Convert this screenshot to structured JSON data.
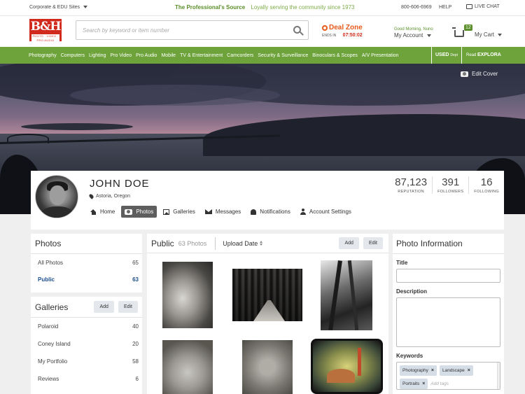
{
  "utilbar": {
    "corp_label": "Corporate & EDU Sites",
    "tagline_pro": "The Professional's Source",
    "tagline_loyal": "Loyally serving the community since 1973",
    "phone": "800-606-6969",
    "help": "HELP",
    "chat": "LIVE CHAT"
  },
  "header": {
    "logo_big": "B&H",
    "logo_small": "PHOTO · VIDEO · PRO AUDIO",
    "search_placeholder": "Search by keyword or item number",
    "dealzone_title": "Deal Zone",
    "dealzone_ends": "ENDS IN",
    "dealzone_time": "07:50:02",
    "greeting": "Good Morning, Nuno",
    "my_account": "My Account",
    "cart_count": "12",
    "my_cart": "My Cart"
  },
  "nav": {
    "items": [
      "Photography",
      "Computers",
      "Lighting",
      "Pro Video",
      "Pro Audio",
      "Mobile",
      "TV & Entertainment",
      "Camcorders",
      "Security & Surveillance",
      "Binoculars & Scopes",
      "A/V Presentation"
    ],
    "used": "USED",
    "used_dept": "Dept",
    "explora_read": "Read",
    "explora": "EXPLORA"
  },
  "cover": {
    "edit_label": "Edit Cover"
  },
  "profile": {
    "name": "JOHN DOE",
    "location": "Astoria, Oregon",
    "tabs": [
      "Home",
      "Photos",
      "Galleries",
      "Messages",
      "Notifications",
      "Account Settings"
    ],
    "active_tab": "Photos",
    "stats": [
      {
        "num": "87,123",
        "label": "REPUTATION"
      },
      {
        "num": "391",
        "label": "FOLLOWERS"
      },
      {
        "num": "16",
        "label": "FOLLOWING"
      }
    ]
  },
  "photos_panel": {
    "title": "Photos",
    "rows": [
      {
        "label": "All Photos",
        "count": "65"
      },
      {
        "label": "Public",
        "count": "63"
      }
    ]
  },
  "galleries_panel": {
    "title": "Galleries",
    "add": "Add",
    "edit": "Edit",
    "rows": [
      {
        "label": "Polaroid",
        "count": "40"
      },
      {
        "label": "Coney Island",
        "count": "20"
      },
      {
        "label": "My Portfolio",
        "count": "58"
      },
      {
        "label": "Reviews",
        "count": "6"
      }
    ]
  },
  "grid_panel": {
    "title": "Public",
    "count": "63 Photos",
    "sort": "Upload Date",
    "add": "Add",
    "edit": "Edit"
  },
  "info_panel": {
    "title": "Photo Information",
    "title_label": "Title",
    "description_label": "Description",
    "keywords_label": "Keywords",
    "keywords": [
      "Photography",
      "Landscape",
      "Portraits"
    ],
    "add_tags_placeholder": "Add tags"
  },
  "colors": {
    "brand_green": "#6da33a",
    "brand_red": "#d12a1c",
    "dealzone_orange": "#e8591a",
    "active_link": "#1d4f8f"
  }
}
